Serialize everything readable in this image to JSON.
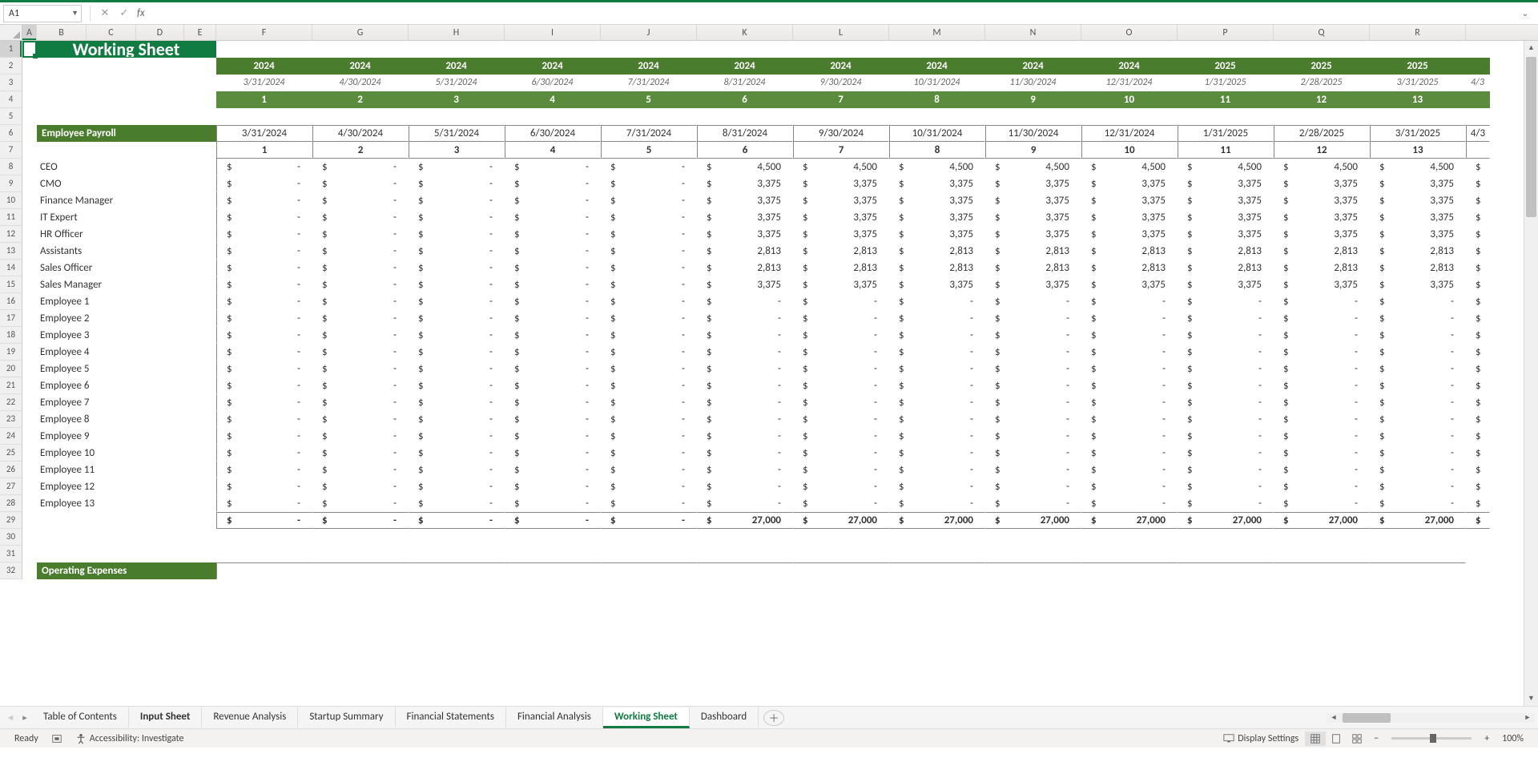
{
  "formula_bar": {
    "name_box": "A1",
    "fx_label": "fx",
    "formula_value": ""
  },
  "columns": [
    "A",
    "B",
    "C",
    "D",
    "E",
    "F",
    "G",
    "H",
    "I",
    "J",
    "K",
    "L",
    "M",
    "N",
    "O",
    "P",
    "Q",
    "R"
  ],
  "column_widths": {
    "A": 18,
    "B": 62,
    "C": 62,
    "D": 60,
    "E": 40,
    "data": 120
  },
  "row_numbers": [
    1,
    2,
    3,
    4,
    5,
    6,
    7,
    8,
    9,
    10,
    11,
    12,
    13,
    14,
    15,
    16,
    17,
    18,
    19,
    20,
    21,
    22,
    23,
    24,
    25,
    26,
    27,
    28,
    29,
    30,
    31,
    32
  ],
  "title": "Working Sheet",
  "top_years": [
    "2024",
    "2024",
    "2024",
    "2024",
    "2024",
    "2024",
    "2024",
    "2024",
    "2024",
    "2024",
    "2025",
    "2025",
    "2025"
  ],
  "top_dates": [
    "3/31/2024",
    "4/30/2024",
    "5/31/2024",
    "6/30/2024",
    "7/31/2024",
    "8/31/2024",
    "9/30/2024",
    "10/31/2024",
    "11/30/2024",
    "12/31/2024",
    "1/31/2025",
    "2/28/2025",
    "3/31/2025"
  ],
  "top_idx": [
    "1",
    "2",
    "3",
    "4",
    "5",
    "6",
    "7",
    "8",
    "9",
    "10",
    "11",
    "12",
    "13"
  ],
  "partial_date_right": "4/3",
  "section1": "Employee Payroll",
  "tbl_dates": [
    "3/31/2024",
    "4/30/2024",
    "5/31/2024",
    "6/30/2024",
    "7/31/2024",
    "8/31/2024",
    "9/30/2024",
    "10/31/2024",
    "11/30/2024",
    "12/31/2024",
    "1/31/2025",
    "2/28/2025",
    "3/31/2025"
  ],
  "tbl_idx": [
    "1",
    "2",
    "3",
    "4",
    "5",
    "6",
    "7",
    "8",
    "9",
    "10",
    "11",
    "12",
    "13"
  ],
  "payroll_rows": [
    {
      "label": "CEO",
      "v": [
        "-",
        "-",
        "-",
        "-",
        "-",
        "4,500",
        "4,500",
        "4,500",
        "4,500",
        "4,500",
        "4,500",
        "4,500",
        "4,500"
      ]
    },
    {
      "label": "CMO",
      "v": [
        "-",
        "-",
        "-",
        "-",
        "-",
        "3,375",
        "3,375",
        "3,375",
        "3,375",
        "3,375",
        "3,375",
        "3,375",
        "3,375"
      ]
    },
    {
      "label": "Finance Manager",
      "v": [
        "-",
        "-",
        "-",
        "-",
        "-",
        "3,375",
        "3,375",
        "3,375",
        "3,375",
        "3,375",
        "3,375",
        "3,375",
        "3,375"
      ]
    },
    {
      "label": "IT Expert",
      "v": [
        "-",
        "-",
        "-",
        "-",
        "-",
        "3,375",
        "3,375",
        "3,375",
        "3,375",
        "3,375",
        "3,375",
        "3,375",
        "3,375"
      ]
    },
    {
      "label": "HR Officer",
      "v": [
        "-",
        "-",
        "-",
        "-",
        "-",
        "3,375",
        "3,375",
        "3,375",
        "3,375",
        "3,375",
        "3,375",
        "3,375",
        "3,375"
      ]
    },
    {
      "label": "Assistants",
      "v": [
        "-",
        "-",
        "-",
        "-",
        "-",
        "2,813",
        "2,813",
        "2,813",
        "2,813",
        "2,813",
        "2,813",
        "2,813",
        "2,813"
      ]
    },
    {
      "label": "Sales Officer",
      "v": [
        "-",
        "-",
        "-",
        "-",
        "-",
        "2,813",
        "2,813",
        "2,813",
        "2,813",
        "2,813",
        "2,813",
        "2,813",
        "2,813"
      ]
    },
    {
      "label": "Sales Manager",
      "v": [
        "-",
        "-",
        "-",
        "-",
        "-",
        "3,375",
        "3,375",
        "3,375",
        "3,375",
        "3,375",
        "3,375",
        "3,375",
        "3,375"
      ]
    },
    {
      "label": "Employee 1",
      "v": [
        "-",
        "-",
        "-",
        "-",
        "-",
        "-",
        "-",
        "-",
        "-",
        "-",
        "-",
        "-",
        "-"
      ]
    },
    {
      "label": "Employee 2",
      "v": [
        "-",
        "-",
        "-",
        "-",
        "-",
        "-",
        "-",
        "-",
        "-",
        "-",
        "-",
        "-",
        "-"
      ]
    },
    {
      "label": "Employee 3",
      "v": [
        "-",
        "-",
        "-",
        "-",
        "-",
        "-",
        "-",
        "-",
        "-",
        "-",
        "-",
        "-",
        "-"
      ]
    },
    {
      "label": "Employee 4",
      "v": [
        "-",
        "-",
        "-",
        "-",
        "-",
        "-",
        "-",
        "-",
        "-",
        "-",
        "-",
        "-",
        "-"
      ]
    },
    {
      "label": "Employee 5",
      "v": [
        "-",
        "-",
        "-",
        "-",
        "-",
        "-",
        "-",
        "-",
        "-",
        "-",
        "-",
        "-",
        "-"
      ]
    },
    {
      "label": "Employee 6",
      "v": [
        "-",
        "-",
        "-",
        "-",
        "-",
        "-",
        "-",
        "-",
        "-",
        "-",
        "-",
        "-",
        "-"
      ]
    },
    {
      "label": "Employee 7",
      "v": [
        "-",
        "-",
        "-",
        "-",
        "-",
        "-",
        "-",
        "-",
        "-",
        "-",
        "-",
        "-",
        "-"
      ]
    },
    {
      "label": "Employee 8",
      "v": [
        "-",
        "-",
        "-",
        "-",
        "-",
        "-",
        "-",
        "-",
        "-",
        "-",
        "-",
        "-",
        "-"
      ]
    },
    {
      "label": "Employee 9",
      "v": [
        "-",
        "-",
        "-",
        "-",
        "-",
        "-",
        "-",
        "-",
        "-",
        "-",
        "-",
        "-",
        "-"
      ]
    },
    {
      "label": "Employee 10",
      "v": [
        "-",
        "-",
        "-",
        "-",
        "-",
        "-",
        "-",
        "-",
        "-",
        "-",
        "-",
        "-",
        "-"
      ]
    },
    {
      "label": "Employee 11",
      "v": [
        "-",
        "-",
        "-",
        "-",
        "-",
        "-",
        "-",
        "-",
        "-",
        "-",
        "-",
        "-",
        "-"
      ]
    },
    {
      "label": "Employee 12",
      "v": [
        "-",
        "-",
        "-",
        "-",
        "-",
        "-",
        "-",
        "-",
        "-",
        "-",
        "-",
        "-",
        "-"
      ]
    },
    {
      "label": "Employee 13",
      "v": [
        "-",
        "-",
        "-",
        "-",
        "-",
        "-",
        "-",
        "-",
        "-",
        "-",
        "-",
        "-",
        "-"
      ]
    }
  ],
  "totals": [
    "-",
    "-",
    "-",
    "-",
    "-",
    "27,000",
    "27,000",
    "27,000",
    "27,000",
    "27,000",
    "27,000",
    "27,000",
    "27,000"
  ],
  "section2": "Operating Expenses",
  "currency_symbol": "$",
  "sheet_tabs": [
    "Table of Contents",
    "Input Sheet",
    "Revenue Analysis",
    "Startup Summary",
    "Financial Statements",
    "Financial Analysis",
    "Working Sheet",
    "Dashboard"
  ],
  "active_tab_index": 6,
  "bold_tab_index": 1,
  "status": {
    "ready": "Ready",
    "accessibility": "Accessibility: Investigate",
    "display": "Display Settings",
    "zoom": "100%"
  },
  "chart_data": {
    "type": "table",
    "title": "Employee Payroll (Working Sheet)",
    "columns": [
      "3/31/2024",
      "4/30/2024",
      "5/31/2024",
      "6/30/2024",
      "7/31/2024",
      "8/31/2024",
      "9/30/2024",
      "10/31/2024",
      "11/30/2024",
      "12/31/2024",
      "1/31/2025",
      "2/28/2025",
      "3/31/2025"
    ],
    "rows": [
      {
        "label": "CEO",
        "values": [
          0,
          0,
          0,
          0,
          0,
          4500,
          4500,
          4500,
          4500,
          4500,
          4500,
          4500,
          4500
        ]
      },
      {
        "label": "CMO",
        "values": [
          0,
          0,
          0,
          0,
          0,
          3375,
          3375,
          3375,
          3375,
          3375,
          3375,
          3375,
          3375
        ]
      },
      {
        "label": "Finance Manager",
        "values": [
          0,
          0,
          0,
          0,
          0,
          3375,
          3375,
          3375,
          3375,
          3375,
          3375,
          3375,
          3375
        ]
      },
      {
        "label": "IT Expert",
        "values": [
          0,
          0,
          0,
          0,
          0,
          3375,
          3375,
          3375,
          3375,
          3375,
          3375,
          3375,
          3375
        ]
      },
      {
        "label": "HR Officer",
        "values": [
          0,
          0,
          0,
          0,
          0,
          3375,
          3375,
          3375,
          3375,
          3375,
          3375,
          3375,
          3375
        ]
      },
      {
        "label": "Assistants",
        "values": [
          0,
          0,
          0,
          0,
          0,
          2813,
          2813,
          2813,
          2813,
          2813,
          2813,
          2813,
          2813
        ]
      },
      {
        "label": "Sales Officer",
        "values": [
          0,
          0,
          0,
          0,
          0,
          2813,
          2813,
          2813,
          2813,
          2813,
          2813,
          2813,
          2813
        ]
      },
      {
        "label": "Sales Manager",
        "values": [
          0,
          0,
          0,
          0,
          0,
          3375,
          3375,
          3375,
          3375,
          3375,
          3375,
          3375,
          3375
        ]
      },
      {
        "label": "Employee 1",
        "values": [
          0,
          0,
          0,
          0,
          0,
          0,
          0,
          0,
          0,
          0,
          0,
          0,
          0
        ]
      },
      {
        "label": "Employee 2",
        "values": [
          0,
          0,
          0,
          0,
          0,
          0,
          0,
          0,
          0,
          0,
          0,
          0,
          0
        ]
      },
      {
        "label": "Employee 3",
        "values": [
          0,
          0,
          0,
          0,
          0,
          0,
          0,
          0,
          0,
          0,
          0,
          0,
          0
        ]
      },
      {
        "label": "Employee 4",
        "values": [
          0,
          0,
          0,
          0,
          0,
          0,
          0,
          0,
          0,
          0,
          0,
          0,
          0
        ]
      },
      {
        "label": "Employee 5",
        "values": [
          0,
          0,
          0,
          0,
          0,
          0,
          0,
          0,
          0,
          0,
          0,
          0,
          0
        ]
      },
      {
        "label": "Employee 6",
        "values": [
          0,
          0,
          0,
          0,
          0,
          0,
          0,
          0,
          0,
          0,
          0,
          0,
          0
        ]
      },
      {
        "label": "Employee 7",
        "values": [
          0,
          0,
          0,
          0,
          0,
          0,
          0,
          0,
          0,
          0,
          0,
          0,
          0
        ]
      },
      {
        "label": "Employee 8",
        "values": [
          0,
          0,
          0,
          0,
          0,
          0,
          0,
          0,
          0,
          0,
          0,
          0,
          0
        ]
      },
      {
        "label": "Employee 9",
        "values": [
          0,
          0,
          0,
          0,
          0,
          0,
          0,
          0,
          0,
          0,
          0,
          0,
          0
        ]
      },
      {
        "label": "Employee 10",
        "values": [
          0,
          0,
          0,
          0,
          0,
          0,
          0,
          0,
          0,
          0,
          0,
          0,
          0
        ]
      },
      {
        "label": "Employee 11",
        "values": [
          0,
          0,
          0,
          0,
          0,
          0,
          0,
          0,
          0,
          0,
          0,
          0,
          0
        ]
      },
      {
        "label": "Employee 12",
        "values": [
          0,
          0,
          0,
          0,
          0,
          0,
          0,
          0,
          0,
          0,
          0,
          0,
          0
        ]
      },
      {
        "label": "Employee 13",
        "values": [
          0,
          0,
          0,
          0,
          0,
          0,
          0,
          0,
          0,
          0,
          0,
          0,
          0
        ]
      }
    ],
    "totals": [
      0,
      0,
      0,
      0,
      0,
      27000,
      27000,
      27000,
      27000,
      27000,
      27000,
      27000,
      27000
    ]
  }
}
